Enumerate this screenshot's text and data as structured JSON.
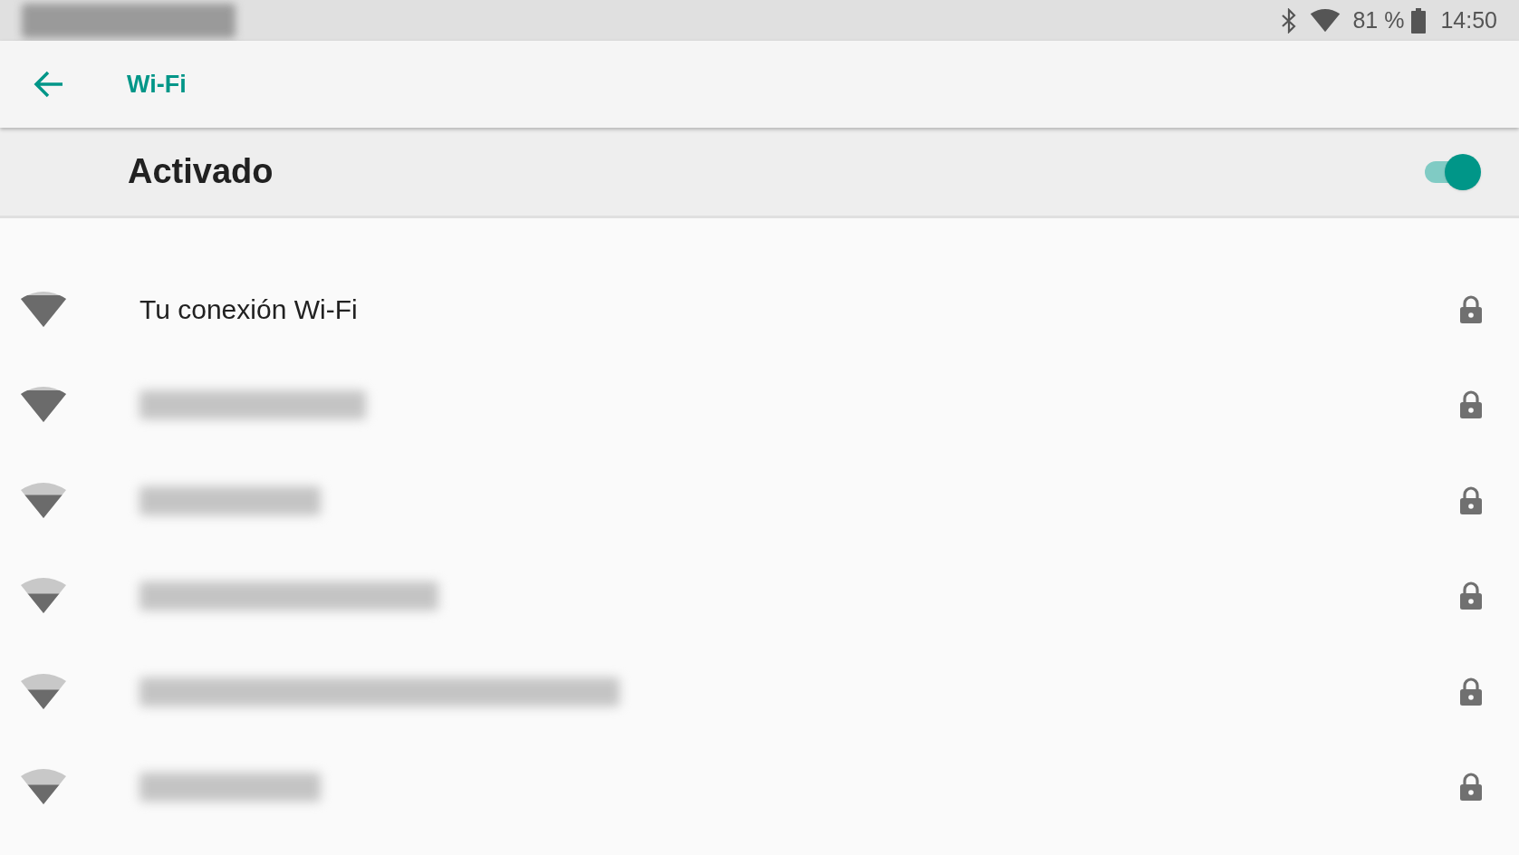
{
  "status_bar": {
    "battery_percent": "81 %",
    "time": "14:50"
  },
  "toolbar": {
    "title": "Wi-Fi"
  },
  "master_switch": {
    "label": "Activado",
    "on": true
  },
  "networks": [
    {
      "name": "Tu conexión Wi-Fi",
      "name_hidden": false,
      "kind": "strong",
      "secured": true
    },
    {
      "name_hidden": true,
      "kind": "strong",
      "secured": true
    },
    {
      "name_hidden": true,
      "kind": "good",
      "secured": true
    },
    {
      "name_hidden": true,
      "kind": "fair",
      "secured": true
    },
    {
      "name_hidden": true,
      "kind": "fair",
      "secured": true
    },
    {
      "name_hidden": true,
      "kind": "fair",
      "secured": true
    }
  ]
}
